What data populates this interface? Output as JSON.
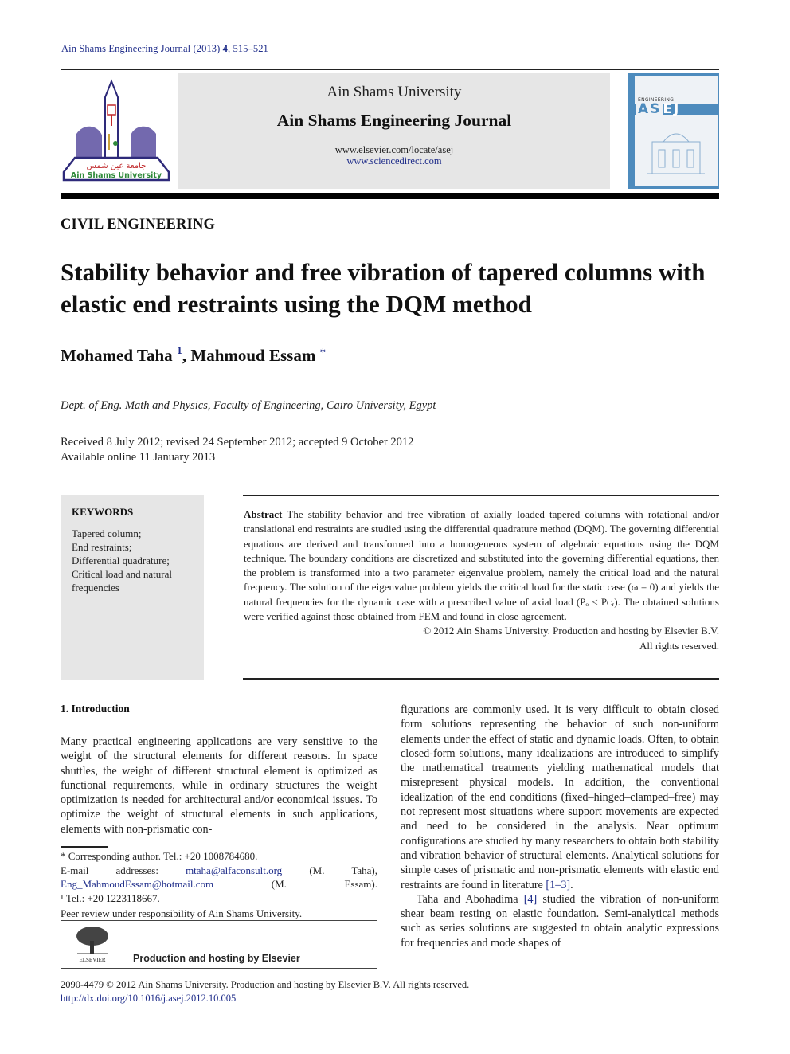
{
  "running_head": {
    "journal": "Ain Shams Engineering Journal (2013)",
    "volume": "4",
    "pages": ", 515–521"
  },
  "banner": {
    "university": "Ain Shams University",
    "journal_name": "Ain Shams Engineering Journal",
    "url_journal": "www.elsevier.com/locate/asej",
    "url_sciencedirect": "www.sciencedirect.com"
  },
  "logo": {
    "arabic_text": "جامعة عين شمس",
    "english_text": "Ain Shams University"
  },
  "cover": {
    "series": "ENGINEERING",
    "acronym_part1": "AS",
    "acronym_part2": "EJ"
  },
  "article": {
    "section": "CIVIL ENGINEERING",
    "title": "Stability behavior and free vibration of tapered columns with elastic end restraints using the DQM method",
    "authors": [
      {
        "name": "Mohamed Taha",
        "mark": "1"
      },
      {
        "name": "Mahmoud Essam",
        "mark": "*"
      }
    ],
    "affiliation": "Dept. of Eng. Math and Physics, Faculty of Engineering, Cairo University, Egypt",
    "received": "Received 8 July 2012; revised 24 September 2012; accepted 9 October 2012",
    "available": "Available online 11 January 2013"
  },
  "keywords": {
    "heading": "KEYWORDS",
    "items": [
      "Tapered column;",
      "End restraints;",
      "Differential quadrature;",
      "Critical load and natural frequencies"
    ]
  },
  "abstract": {
    "label": "Abstract",
    "text": "The stability behavior and free vibration of axially loaded tapered columns with rotational and/or translational end restraints are studied using the differential quadrature method (DQM). The governing differential equations are derived and transformed into a homogeneous system of algebraic equations using the DQM technique. The boundary conditions are discretized and substituted into the governing differential equations, then the problem is transformed into a two parameter eigenvalue problem, namely the critical load and the natural frequency. The solution of the eigenvalue problem yields the critical load for the static case (ω = 0) and yields the natural frequencies for the dynamic case with a prescribed value of axial load (Pₒ < Pᴄᵣ). The obtained solutions were verified against those obtained from FEM and found in close agreement.",
    "copyright": "© 2012 Ain Shams University. Production and hosting by Elsevier B.V.",
    "rights": "All rights reserved."
  },
  "introduction": {
    "heading": "1. Introduction",
    "left_col": "Many practical engineering applications are very sensitive to the weight of the structural elements for different reasons. In space shuttles, the weight of different structural element is optimized as functional requirements, while in ordinary structures the weight optimization is needed for architectural and/or economical issues. To optimize the weight of structural elements in such applications, elements with non-prismatic con-",
    "right_col_p1_a": "figurations are commonly used. It is very difficult to obtain closed form solutions representing the behavior of such non-uniform elements under the effect of static and dynamic loads. Often, to obtain closed-form solutions, many idealizations are introduced to simplify the mathematical treatments yielding mathematical models that misrepresent physical models. In addition, the conventional idealization of the end conditions (fixed–hinged–clamped–free) may not represent most situations where support movements are expected and need to be considered in the analysis. Near optimum configurations are studied by many researchers to obtain both stability and vibration behavior of structural elements. Analytical solutions for simple cases of prismatic and non-prismatic elements with elastic end restraints are found in literature ",
    "ref_1_3": "[1–3]",
    "right_col_p1_end": ".",
    "right_col_p2_a": "Taha and Abohadima ",
    "ref_4": "[4]",
    "right_col_p2_b": " studied the vibration of non-uniform shear beam resting on elastic foundation. Semi-analytical methods such as series solutions are suggested to obtain analytic expressions for frequencies and mode shapes of"
  },
  "footnotes": {
    "corresponding": "* Corresponding author. Tel.: +20 1008784680.",
    "email_label": "E-mail addresses: ",
    "email1": "mtaha@alfaconsult.org",
    "email1_owner": " (M. Taha), ",
    "email2": "Eng_MahmoudEssam@hotmail.com",
    "email2_owner": " (M. Essam).",
    "note1": "¹ Tel.: +20 1223118667.",
    "peer_review": "Peer review under responsibility of Ain Shams University."
  },
  "elsevier_box": {
    "logo_text": "ELSEVIER",
    "label": "Production and hosting by Elsevier"
  },
  "bottom": {
    "issn_line": "2090-4479 © 2012 Ain Shams University. Production and hosting by Elsevier B.V. All rights reserved.",
    "doi": "http://dx.doi.org/10.1016/j.asej.2012.10.005"
  }
}
